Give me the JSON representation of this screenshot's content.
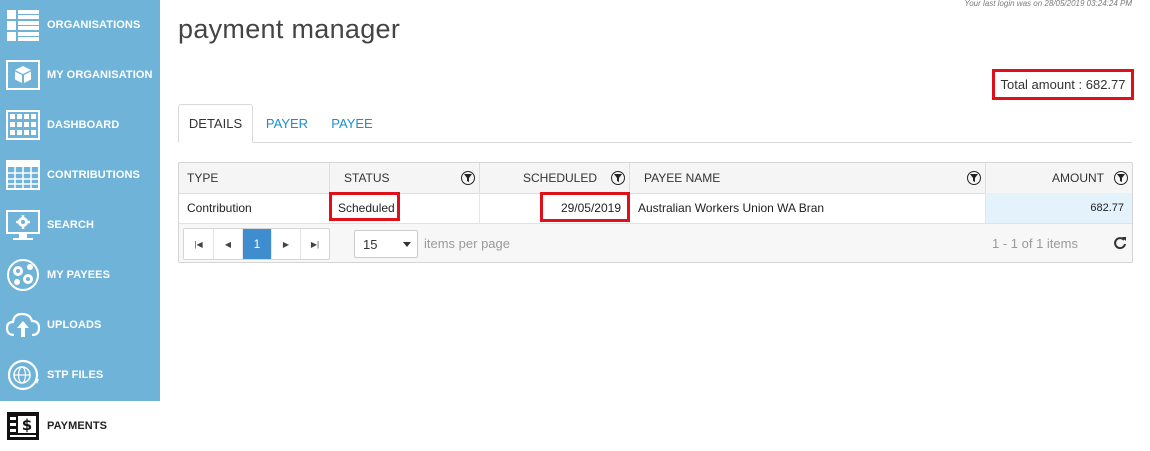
{
  "sidebar": {
    "items": [
      {
        "label": "ORGANISATIONS",
        "icon": "organisations-grid-icon"
      },
      {
        "label": "MY ORGANISATION",
        "icon": "cube-box-icon"
      },
      {
        "label": "DASHBOARD",
        "icon": "dashboard-grid-icon"
      },
      {
        "label": "CONTRIBUTIONS",
        "icon": "calendar-table-icon"
      },
      {
        "label": "SEARCH",
        "icon": "monitor-gear-icon"
      },
      {
        "label": "MY PAYEES",
        "icon": "network-gears-icon"
      },
      {
        "label": "UPLOADS",
        "icon": "cloud-upload-icon"
      },
      {
        "label": "STP FILES",
        "icon": "globe-refresh-icon"
      },
      {
        "label": "PAYMENTS",
        "icon": "dollar-document-icon"
      }
    ],
    "active_index": 8
  },
  "header": {
    "login_info": "Your last login was on 28/05/2019 03:24:24 PM",
    "title": "payment manager",
    "total": "Total amount : 682.77"
  },
  "tabs": [
    {
      "label": "DETAILS",
      "active": true
    },
    {
      "label": "PAYER",
      "active": false
    },
    {
      "label": "PAYEE",
      "active": false
    }
  ],
  "grid": {
    "columns": {
      "type": "TYPE",
      "status": "STATUS",
      "scheduled": "SCHEDULED",
      "payee_name": "PAYEE NAME",
      "amount": "AMOUNT"
    },
    "rows": [
      {
        "type": "Contribution",
        "status": "Scheduled",
        "scheduled": "29/05/2019",
        "payee_name": "Australian Workers Union WA Bran",
        "amount": "682.77"
      }
    ],
    "pager": {
      "current_page": "1",
      "page_size": "15",
      "items_per_page": "items per page",
      "info": "1 - 1 of 1 items"
    }
  },
  "colors": {
    "sidebar_bg": "#6fb3d8",
    "highlight": "#e0101a",
    "link": "#1a8fcf",
    "page_active": "#3f8ccf",
    "amount_cell_bg": "#e4f2fb"
  }
}
